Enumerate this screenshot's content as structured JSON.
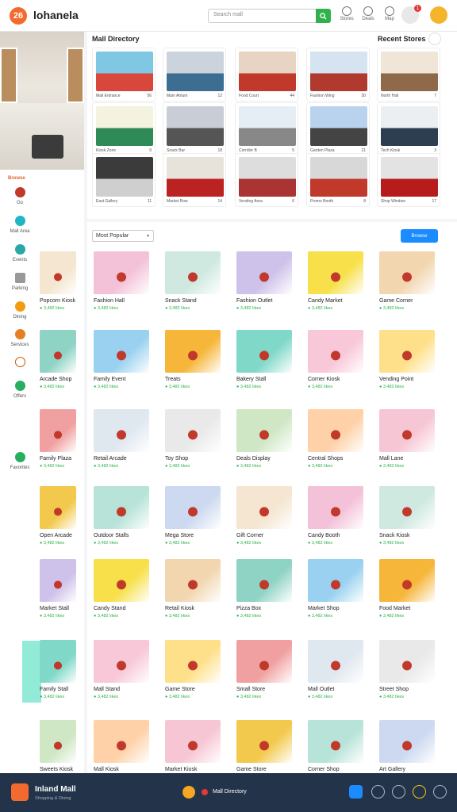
{
  "app": {
    "brand": "lohanela",
    "logo_text": "26"
  },
  "search": {
    "placeholder": "Search mall"
  },
  "top_icons": [
    {
      "label": "Stores",
      "icon": "store-icon"
    },
    {
      "label": "Deals",
      "icon": "tag-icon"
    },
    {
      "label": "Map",
      "icon": "map-icon"
    }
  ],
  "notifications": {
    "count": "1"
  },
  "sidebar": {
    "section": "Browse",
    "items": [
      {
        "label": "Go",
        "icon": "clock-icon",
        "color": "#c0392b"
      },
      {
        "label": "Mall Area",
        "icon": "cart-icon",
        "color": "#1fb6c4"
      },
      {
        "label": "Events",
        "icon": "heart-icon",
        "color": "#2aa7a7"
      },
      {
        "label": "Parking",
        "icon": "box-icon",
        "color": "#999999"
      },
      {
        "label": "Dining",
        "icon": "food-icon",
        "color": "#f39c12"
      },
      {
        "label": "Services",
        "icon": "tag-icon",
        "color": "#e67e22"
      },
      {
        "label": "",
        "icon": "info-icon",
        "color": "#d35400"
      },
      {
        "label": "Offers",
        "icon": "check-icon",
        "color": "#27ae60"
      },
      {
        "label": "Favorites",
        "icon": "check-icon",
        "color": "#27ae60"
      }
    ]
  },
  "featured": {
    "title_left": "Mall Directory",
    "title_right": "Recent Stores",
    "cards": [
      {
        "caption": "Mall Entrance",
        "stat": "56"
      },
      {
        "caption": "Main Atrium",
        "stat": "12"
      },
      {
        "caption": "Food Court",
        "stat": "44"
      },
      {
        "caption": "Fashion Wing",
        "stat": "30"
      },
      {
        "caption": "North Hall",
        "stat": "7"
      },
      {
        "caption": "Kiosk Zone",
        "stat": "9"
      },
      {
        "caption": "Snack Bar",
        "stat": "18"
      },
      {
        "caption": "Corridor B",
        "stat": "5"
      },
      {
        "caption": "Garden Plaza",
        "stat": "21"
      },
      {
        "caption": "Tech Kiosk",
        "stat": "3"
      },
      {
        "caption": "East Gallery",
        "stat": "11"
      },
      {
        "caption": "Market Row",
        "stat": "14"
      },
      {
        "caption": "Vending Area",
        "stat": "6"
      },
      {
        "caption": "Promo Booth",
        "stat": "8"
      },
      {
        "caption": "Shop Window",
        "stat": "17"
      }
    ]
  },
  "grid": {
    "sort_label": "Most Popular",
    "action_button": "Browse",
    "items": [
      {
        "title": "Popcorn Kiosk",
        "sub": "● 3,482 likes"
      },
      {
        "title": "Fashion Hall",
        "sub": "● 3,482 likes"
      },
      {
        "title": "Snack Stand",
        "sub": "● 3,482 likes"
      },
      {
        "title": "Fashion Outlet",
        "sub": "● 3,482 likes"
      },
      {
        "title": "Candy Market",
        "sub": "● 3,482 likes"
      },
      {
        "title": "Game Corner",
        "sub": "● 3,482 likes"
      },
      {
        "title": "Arcade Shop",
        "sub": "● 3,482 likes"
      },
      {
        "title": "Family Event",
        "sub": "● 3,482 likes"
      },
      {
        "title": "Treats",
        "sub": "● 3,482 likes"
      },
      {
        "title": "Bakery Stall",
        "sub": "● 3,482 likes"
      },
      {
        "title": "Corner Kiosk",
        "sub": "● 3,482 likes"
      },
      {
        "title": "Vending Point",
        "sub": "● 3,482 likes"
      },
      {
        "title": "Family Plaza",
        "sub": "● 3,482 likes"
      },
      {
        "title": "Retail Arcade",
        "sub": "● 3,482 likes"
      },
      {
        "title": "Toy Shop",
        "sub": "● 3,482 likes"
      },
      {
        "title": "Deals Display",
        "sub": "● 3,482 likes"
      },
      {
        "title": "Central Shops",
        "sub": "● 3,482 likes"
      },
      {
        "title": "Mall Lane",
        "sub": "● 3,482 likes"
      },
      {
        "title": "Open Arcade",
        "sub": "● 3,482 likes"
      },
      {
        "title": "Outdoor Stalls",
        "sub": "● 3,482 likes"
      },
      {
        "title": "Mega Store",
        "sub": "● 3,482 likes"
      },
      {
        "title": "Gift Corner",
        "sub": "● 3,482 likes"
      },
      {
        "title": "Candy Booth",
        "sub": "● 3,482 likes"
      },
      {
        "title": "Snack Kiosk",
        "sub": "● 3,482 likes"
      },
      {
        "title": "Market Stall",
        "sub": "● 3,482 likes"
      },
      {
        "title": "Candy Stand",
        "sub": "● 3,482 likes"
      },
      {
        "title": "Retail Kiosk",
        "sub": "● 3,482 likes"
      },
      {
        "title": "Pizza Box",
        "sub": "● 3,482 likes"
      },
      {
        "title": "Market Shop",
        "sub": "● 3,482 likes"
      },
      {
        "title": "Food Market",
        "sub": "● 3,482 likes"
      },
      {
        "title": "Family Stall",
        "sub": "● 3,482 likes"
      },
      {
        "title": "Mall Stand",
        "sub": "● 3,482 likes"
      },
      {
        "title": "Game Store",
        "sub": "● 3,482 likes"
      },
      {
        "title": "Small Store",
        "sub": "● 3,482 likes"
      },
      {
        "title": "Mall Outlet",
        "sub": "● 3,482 likes"
      },
      {
        "title": "Street Shop",
        "sub": "● 3,482 likes"
      },
      {
        "title": "Sweets Kiosk",
        "sub": ""
      },
      {
        "title": "Mall Kiosk",
        "sub": ""
      },
      {
        "title": "Market Kiosk",
        "sub": ""
      },
      {
        "title": "Game Store",
        "sub": ""
      },
      {
        "title": "Corner Shop",
        "sub": ""
      },
      {
        "title": "Art Gallery",
        "sub": ""
      }
    ]
  },
  "bottom_bar": {
    "title": "Inland Mall",
    "subtitle": "Shopping & Dining",
    "center_text": "Mall Directory",
    "icons": [
      "chat-icon",
      "help-icon",
      "settings-icon",
      "star-icon",
      "user-icon"
    ]
  }
}
